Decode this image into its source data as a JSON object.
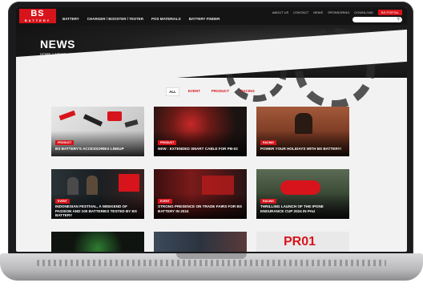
{
  "brand": {
    "logo_main": "BS",
    "logo_sub": "BATTERY",
    "accent": "#d7141b"
  },
  "header": {
    "nav": [
      "BATTERY",
      "CHARGER / BOOSTER / TESTER",
      "POS MATERIALS",
      "BATTERY FINDER"
    ],
    "util": [
      "ABOUT US",
      "CONTACT",
      "NEWS",
      "SPONSORING",
      "DOWNLOAD"
    ],
    "portal_label": "BS PORTAL",
    "search_icon": "search-icon"
  },
  "hero": {
    "title": "NEWS",
    "breadcrumb": "HOME  >  NEWS"
  },
  "filters": [
    "ALL",
    "EVENT",
    "PRODUCT",
    "RACING"
  ],
  "cards": [
    {
      "badge": "PRODUCT",
      "title": "BS BATTERY'S ACCESSORIES LINEUP",
      "bg": "#d9d9d9"
    },
    {
      "badge": "PRODUCT",
      "title": "NEW : EXTENDED SMART CABLE FOR PB-02",
      "bg": "#3a2220"
    },
    {
      "badge": "RACING",
      "title": "POWER YOUR HOLIDAYS WITH BS BATTERY!",
      "bg": "#7a3a25"
    },
    {
      "badge": "EVENT",
      "title": "INDONESIAN FESTIVAL, A WEEKEND OF PASSION AND 100 BATTERIES TESTED BY BS BATTERY",
      "bg": "#1f2a2e"
    },
    {
      "badge": "EVENT",
      "title": "STRONG PRESENCE ON TRADE FAIRS FOR BS BATTERY IN 2024",
      "bg": "#5a1414"
    },
    {
      "badge": "RACING",
      "title": "THRILLING LAUNCH OF THE IPONE ENDURANCE CUP 2024 IN PAU",
      "bg": "#2e3a2a"
    },
    {
      "badge": "",
      "title": "",
      "bg": "#0f1410"
    },
    {
      "badge": "",
      "title": "",
      "bg": "#2b3440"
    },
    {
      "badge": "",
      "title": "PR01",
      "bg": "#e9e9ea"
    }
  ]
}
